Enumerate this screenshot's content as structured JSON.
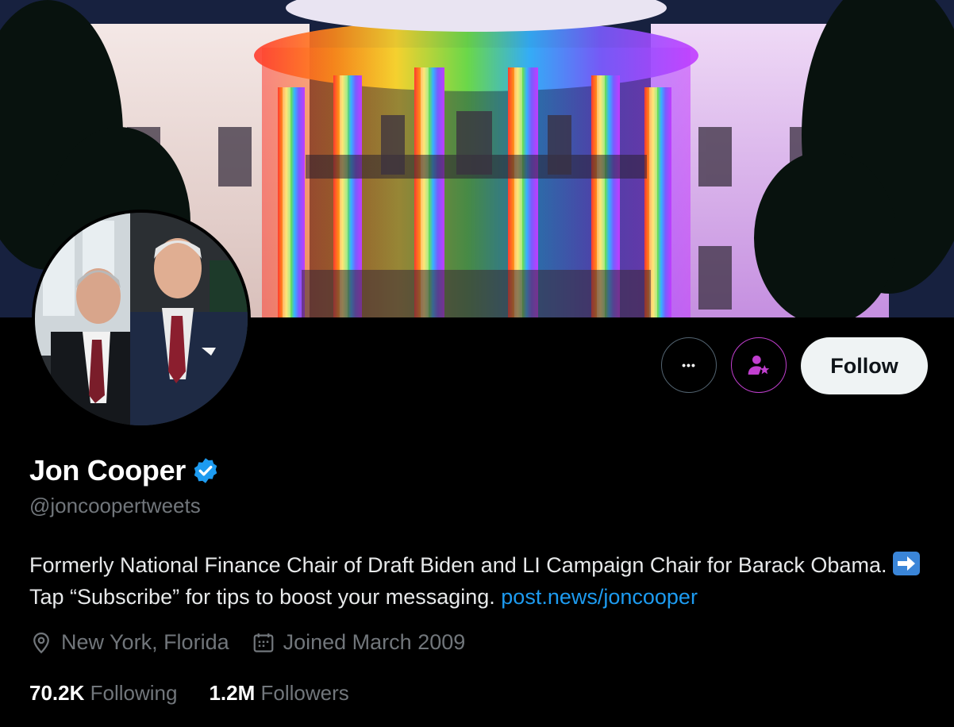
{
  "profile": {
    "name": "Jon Cooper",
    "handle": "@joncoopertweets",
    "bio_text": "Formerly National Finance Chair of Draft Biden and LI Campaign Chair for Barack Obama. ",
    "bio_tap": "Tap “Subscribe” for tips to boost your messaging. ",
    "bio_link": "post.news/joncooper",
    "location": "New York, Florida",
    "joined": "Joined March 2009",
    "following_count": "70.2K",
    "following_label": "Following",
    "followers_count": "1.2M",
    "followers_label": "Followers"
  },
  "actions": {
    "more": "•••",
    "follow": "Follow"
  },
  "icons": {
    "verified": "verified-badge-icon",
    "location": "location-pin-icon",
    "calendar": "calendar-icon",
    "subscribe": "person-star-icon",
    "arrow": "right-arrow-emoji-icon"
  },
  "colors": {
    "link": "#1d9bf0",
    "verified": "#1d9bf0",
    "subscribe_accent": "#c13fcf",
    "follow_bg": "#eff3f4"
  }
}
